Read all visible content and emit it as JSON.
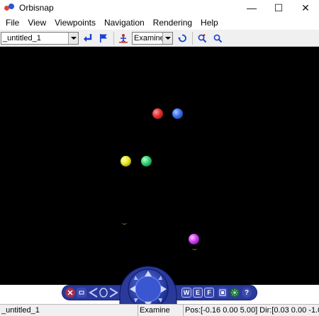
{
  "window": {
    "title": "Orbisnap",
    "minimize_glyph": "—",
    "maximize_glyph": "☐",
    "close_glyph": "✕"
  },
  "menu": [
    "File",
    "View",
    "Viewpoints",
    "Navigation",
    "Rendering",
    "Help"
  ],
  "toolbar": {
    "world_select": "_untitled_1",
    "mode_select": "Examine",
    "icons": [
      "return-arrow-icon",
      "flag-icon",
      "navigation-person-icon",
      "undo-rotate-icon",
      "zoom-in-icon",
      "zoom-fit-icon"
    ]
  },
  "scene": {
    "objects": [
      {
        "name": "red-sphere",
        "color": "#e03030"
      },
      {
        "name": "blue-sphere",
        "color": "#3a70f0"
      },
      {
        "name": "yellow-sphere",
        "color": "#e8e820"
      },
      {
        "name": "green-sphere",
        "color": "#30d070"
      },
      {
        "name": "magenta-sphere",
        "color": "#d040f0"
      }
    ]
  },
  "navpanel": {
    "walk_label": "W",
    "examine_label": "E",
    "fly_label": "F",
    "help_label": "?"
  },
  "status": {
    "world": "_untitled_1",
    "mode": "Examine",
    "position": "Pos:[-0.16 0.00 5.00] Dir:[0.03 0.00 -1.0"
  },
  "colors": {
    "navpanel": "#2a3a9a",
    "accent_blue": "#1a3fd0"
  }
}
